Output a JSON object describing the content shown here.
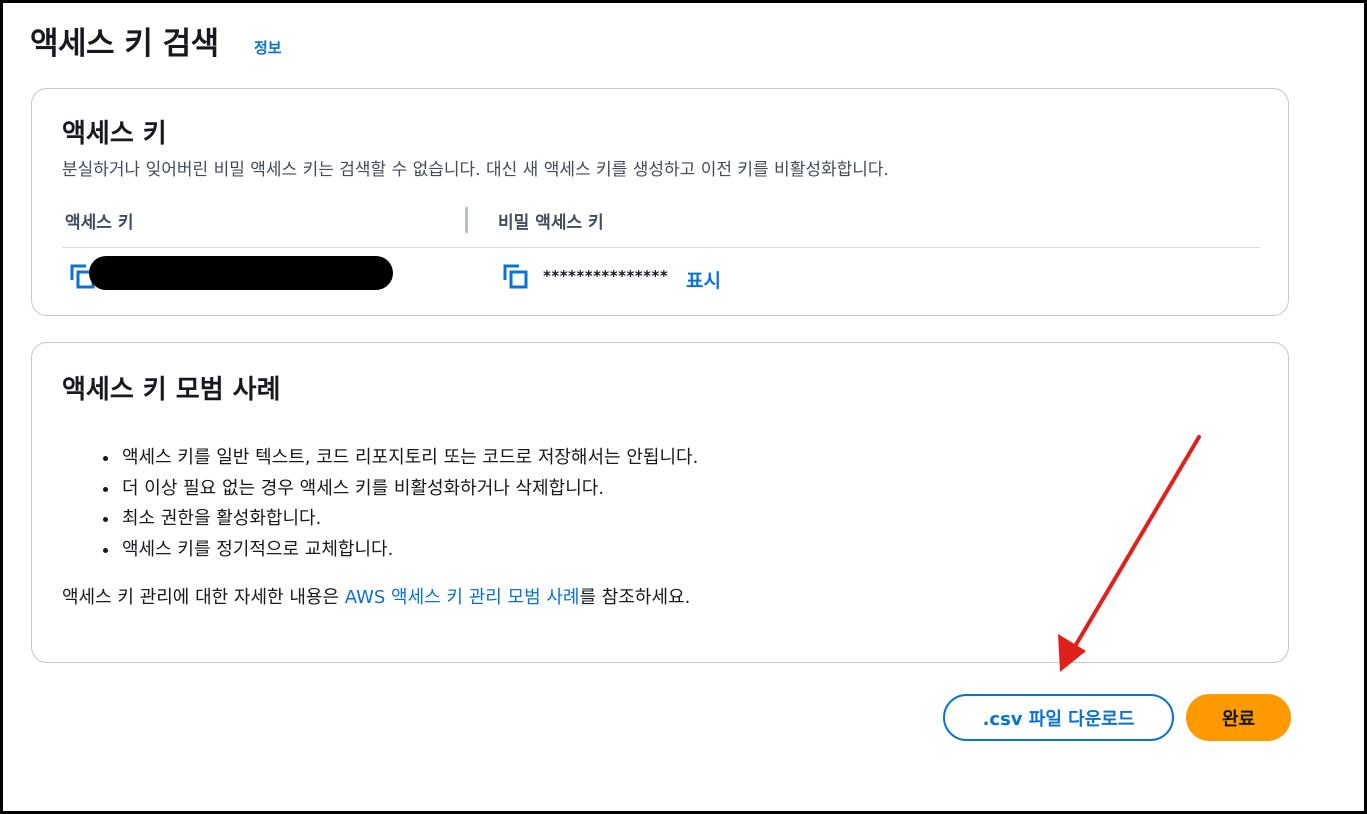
{
  "header": {
    "title": "액세스 키 검색",
    "info_link": "정보"
  },
  "access_key_card": {
    "title": "액세스 키",
    "description": "분실하거나 잊어버린 비밀 액세스 키는 검색할 수 없습니다. 대신 새 액세스 키를 생성하고 이전 키를 비활성화합니다.",
    "columns": [
      "액세스 키",
      "비밀 액세스 키"
    ],
    "access_key_value": "",
    "secret_key_masked": "***************",
    "show_label": "표시",
    "icons": [
      "copy-icon",
      "copy-icon"
    ]
  },
  "best_practices_card": {
    "title": "액세스 키 모범 사례",
    "items": [
      "액세스 키를 일반 텍스트, 코드 리포지토리 또는 코드로 저장해서는 안됩니다.",
      "더 이상 필요 없는 경우 액세스 키를 비활성화하거나 삭제합니다.",
      "최소 권한을 활성화합니다.",
      "액세스 키를 정기적으로 교체합니다."
    ],
    "reference_prefix": "액세스 키 관리에 대한 자세한 내용은 ",
    "reference_link": "AWS 액세스 키 관리 모범 사례",
    "reference_suffix": "를 참조하세요."
  },
  "actions": {
    "download_csv": ".csv 파일 다운로드",
    "done": "완료"
  },
  "colors": {
    "link": "#0972d3",
    "primary_button": "#ff9900",
    "annotation_arrow": "#e0201b"
  }
}
